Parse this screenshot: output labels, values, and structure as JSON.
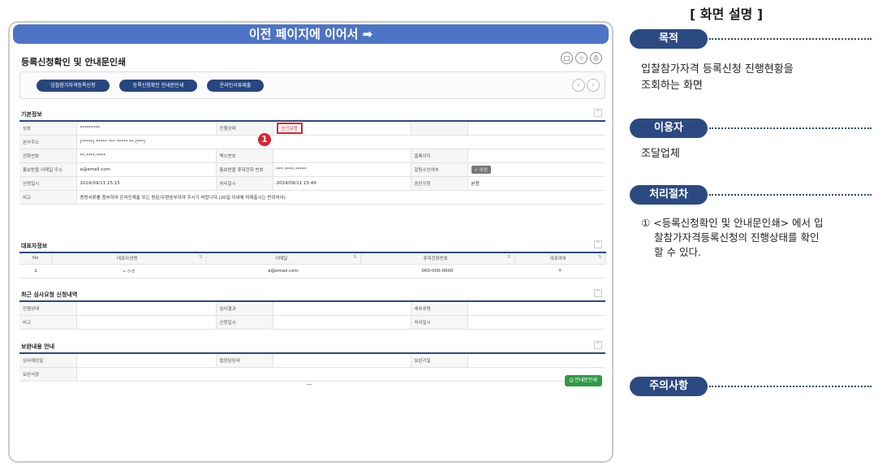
{
  "banner": "이전 페이지에 이어서 ➡",
  "page_title": "등록신청확인 및 안내문인쇄",
  "tool_icons": [
    "□",
    "☆",
    "⎙"
  ],
  "steps": [
    "입찰참가자격등록신청",
    "등록신청확인 안내문인쇄",
    "온라인서류제출"
  ],
  "nav": [
    "‹",
    "›"
  ],
  "basic": {
    "title": "기본정보",
    "rows": [
      [
        {
          "l": "상호",
          "v": "*********"
        },
        {
          "l": "진행상태",
          "v": "승인요청",
          "status": true
        },
        {
          "l": "",
          "v": ""
        }
      ],
      [
        {
          "l": "본사주소",
          "v": "(*****) ***** *** ***** ** (***)",
          "span": true
        }
      ],
      [
        {
          "l": "전화번호",
          "v": "**-****-****"
        },
        {
          "l": "팩스번호",
          "v": ""
        },
        {
          "l": "홈페이지",
          "v": ""
        }
      ],
      [
        {
          "l": "통보받을 이메일 주소",
          "v": "a@email.com"
        },
        {
          "l": "통보받을 휴대전화 번호",
          "v": "***-****-*****"
        },
        {
          "l": "알림수신여부",
          "v": "✓ 수신",
          "btn": true
        }
      ],
      [
        {
          "l": "신청일시",
          "v": "2024/09/11 15:15"
        },
        {
          "l": "처리일시",
          "v": "2024/09/11 15:49"
        },
        {
          "l": "승인지청",
          "v": "본청"
        }
      ],
      [
        {
          "l": "비고",
          "v": "증빙서류를 첨부하여 온라인제출 또는 방문/우편송부하여 주시기 바랍니다.(20일 이내에 미제출시는 반려처리).",
          "span": true
        }
      ]
    ]
  },
  "rep": {
    "title": "대표자정보",
    "headers": [
      "No",
      "대표자성명",
      "이메일",
      "휴대전화번호",
      "대표여부"
    ],
    "rows": [
      [
        "1",
        "ㄴㅇㄹ",
        "a@email.com",
        "000-000-0000",
        "Y"
      ]
    ]
  },
  "recent": {
    "title": "최근 심사요청 신청내역",
    "rows": [
      [
        {
          "l": "진행상태",
          "v": ""
        },
        {
          "l": "심사결과",
          "v": ""
        },
        {
          "l": "세부호명",
          "v": ""
        }
      ],
      [
        {
          "l": "비고",
          "v": ""
        },
        {
          "l": "신청일시",
          "v": ""
        },
        {
          "l": "처리일시",
          "v": ""
        }
      ]
    ]
  },
  "supplement": {
    "title": "보완내용 안내",
    "rows": [
      [
        {
          "l": "심사예정일",
          "v": ""
        },
        {
          "l": "협정담당자",
          "v": ""
        },
        {
          "l": "보완기일",
          "v": ""
        }
      ],
      [
        {
          "l": "보완사항",
          "v": "",
          "span": true
        }
      ]
    ]
  },
  "marker": "1",
  "print_button": "⎙ 안내문인쇄",
  "panel": {
    "title": "[ 화면 설명 ]",
    "purpose_label": "목적",
    "purpose_text": [
      "입찰참가자격 등록신청 진행현황을",
      "조회하는 화면"
    ],
    "user_label": "이용자",
    "user_text": "조달업체",
    "process_label": "처리절차",
    "process_text": [
      "① <등록신청확인 및 안내문인쇄> 에서 입",
      "찰참가자격등록신청의 진행상태를 확인",
      "할 수 있다."
    ],
    "caution_label": "주의사항"
  }
}
